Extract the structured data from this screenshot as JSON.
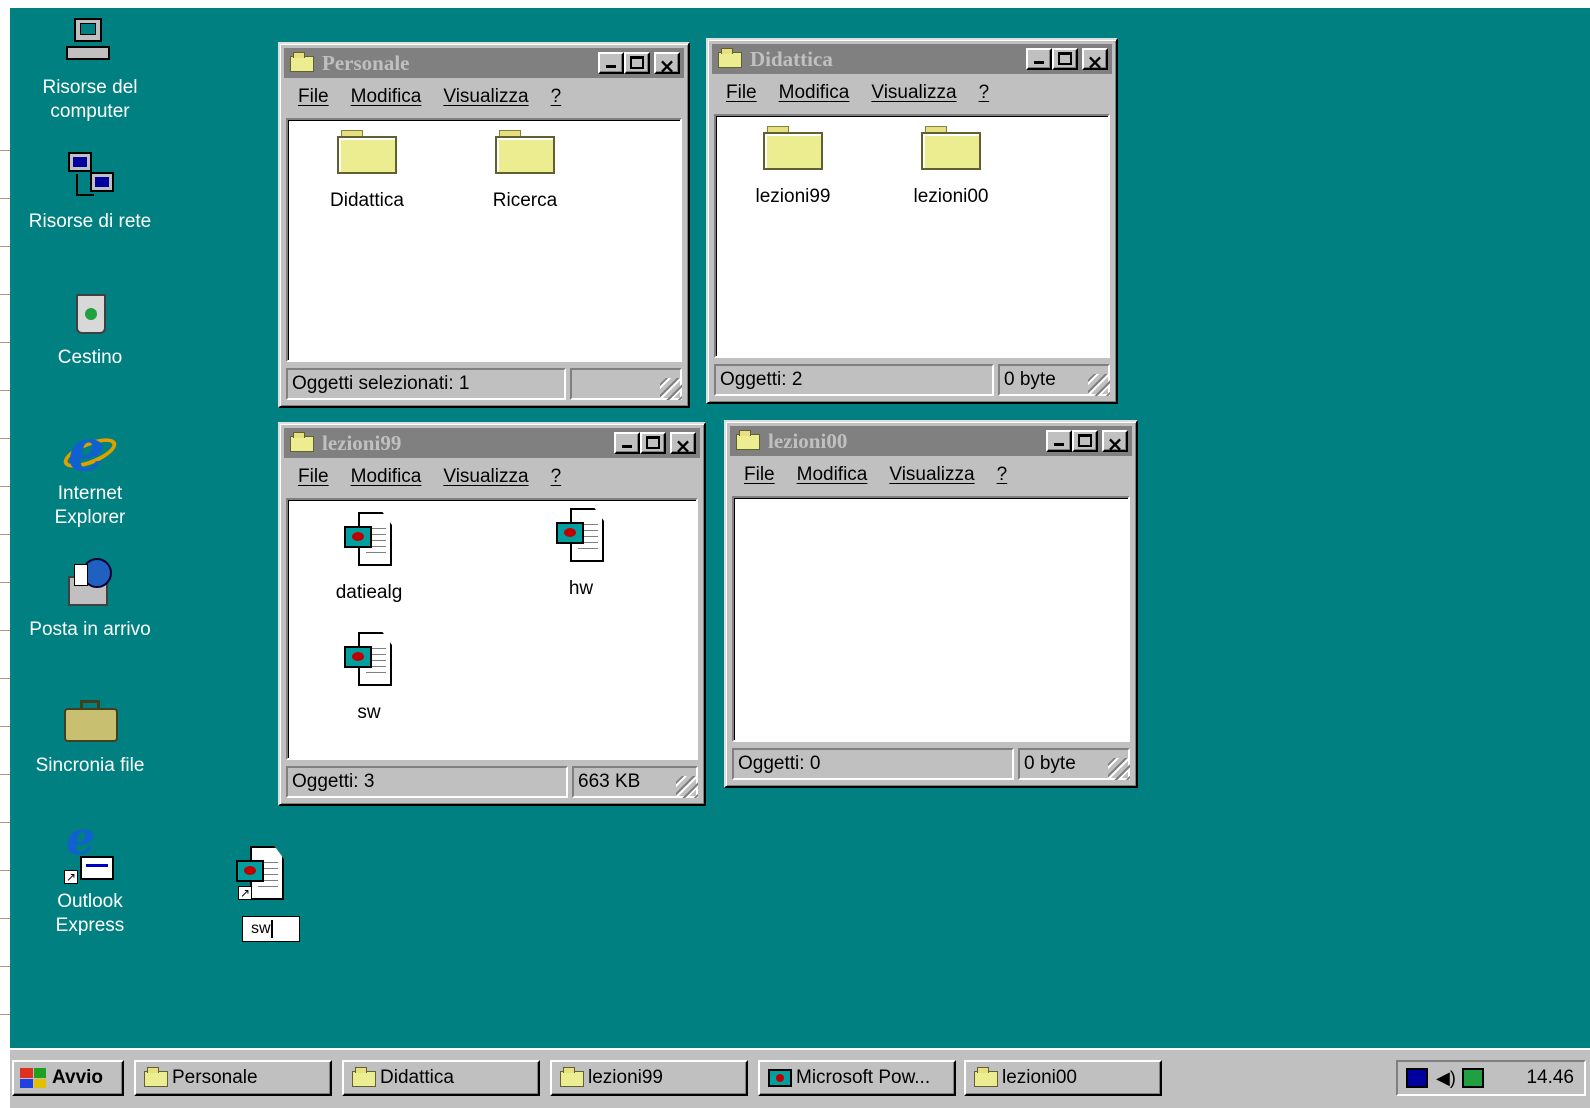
{
  "desktop_icons": [
    {
      "label": "Risorse del computer",
      "icon": "my-computer-icon"
    },
    {
      "label": "Risorse di rete",
      "icon": "network-neighborhood-icon"
    },
    {
      "label": "Cestino",
      "icon": "recycle-bin-icon"
    },
    {
      "label": "Internet Explorer",
      "icon": "internet-explorer-icon"
    },
    {
      "label": "Posta in arrivo",
      "icon": "inbox-icon"
    },
    {
      "label": "Sincronia file",
      "icon": "briefcase-icon"
    },
    {
      "label": "Outlook Express",
      "icon": "outlook-express-icon"
    }
  ],
  "dragged_icon": {
    "label": "sw",
    "icon": "powerpoint-shortcut-icon"
  },
  "menu": {
    "file": "File",
    "edit": "Modifica",
    "view": "Visualizza",
    "help": "?"
  },
  "windows": {
    "personale": {
      "title": "Personale",
      "items": [
        "Didattica",
        "Ricerca"
      ],
      "status_left": "Oggetti selezionati: 1",
      "status_right": ""
    },
    "didattica": {
      "title": "Didattica",
      "items": [
        "lezioni99",
        "lezioni00"
      ],
      "status_left": "Oggetti: 2",
      "status_right": "0 byte"
    },
    "lezioni99": {
      "title": "lezioni99",
      "items": [
        "datiealg",
        "hw",
        "sw"
      ],
      "status_left": "Oggetti: 3",
      "status_right": "663 KB"
    },
    "lezioni00": {
      "title": "lezioni00",
      "items": [],
      "status_left": "Oggetti: 0",
      "status_right": "0 byte"
    }
  },
  "taskbar": {
    "start": "Avvio",
    "buttons": [
      "Personale",
      "Didattica",
      "lezioni99",
      "Microsoft Pow...",
      "lezioni00"
    ],
    "clock": "14.46"
  },
  "colors": {
    "desktop": "#008080",
    "chrome": "#c0c0c0",
    "inactive_title": "#808080"
  }
}
